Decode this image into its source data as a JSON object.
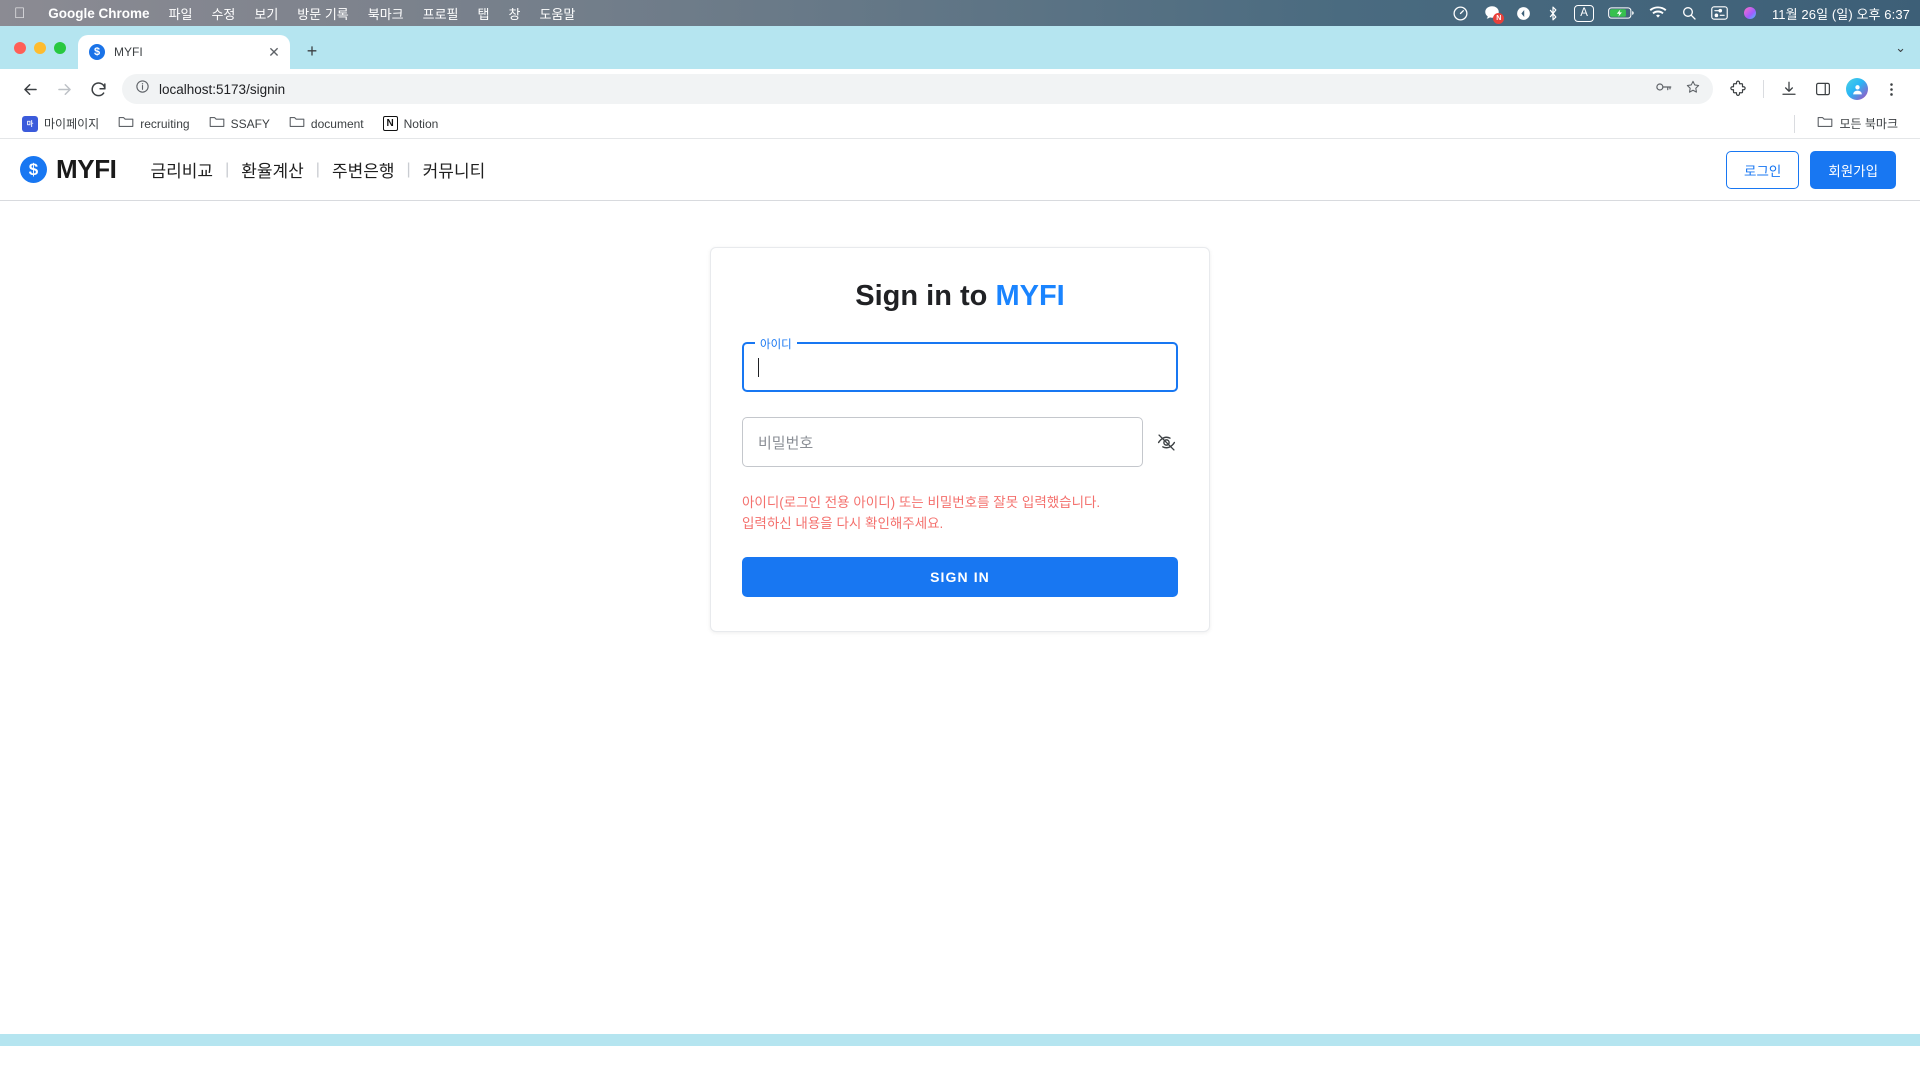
{
  "os_menubar": {
    "apple_icon": "apple-logo",
    "app_name": "Google Chrome",
    "menus": [
      "파일",
      "수정",
      "보기",
      "방문 기록",
      "북마크",
      "프로필",
      "탭",
      "창",
      "도움말"
    ],
    "status_icons": [
      "timer-icon",
      "messages-icon",
      "dropbox-icon",
      "bluetooth-icon",
      "input-source-icon",
      "battery-icon",
      "wifi-icon",
      "search-icon",
      "control-center-icon",
      "siri-icon"
    ],
    "input_source_label": "A",
    "messages_badge": "N",
    "datetime": "11월 26일 (일) 오후 6:37"
  },
  "browser": {
    "tab": {
      "favicon": "dollar-circle-favicon",
      "favicon_glyph": "$",
      "title": "MYFI",
      "close_label": "✕"
    },
    "new_tab_label": "+",
    "tab_list_chevron": "⌄",
    "toolbar": {
      "back_label": "←",
      "forward_label": "→",
      "reload_label": "⟳",
      "site_info_icon": "info-circle-icon",
      "url": "localhost:5173/signin",
      "password_key_icon": "password-key-icon",
      "bookmark_star_icon": "star-icon",
      "extensions_icon": "extensions-puzzle-icon",
      "downloads_icon": "download-icon",
      "side_panel_icon": "side-panel-icon",
      "profile_icon": "profile-avatar",
      "menu_icon": "three-dots-menu-icon"
    },
    "bookmarks": [
      {
        "label": "마이페이지",
        "icon": "site-favicon",
        "icon_glyph": "마"
      },
      {
        "label": "recruiting",
        "icon": "folder-icon"
      },
      {
        "label": "SSAFY",
        "icon": "folder-icon"
      },
      {
        "label": "document",
        "icon": "folder-icon"
      },
      {
        "label": "Notion",
        "icon": "notion-favicon",
        "icon_glyph": "N"
      }
    ],
    "bookmarks_overflow": {
      "label": "모든 북마크",
      "icon": "folder-icon"
    }
  },
  "site": {
    "brand": {
      "mark_glyph": "$",
      "name": "MYFI"
    },
    "nav": [
      {
        "label": "금리비교"
      },
      {
        "label": "환율계산"
      },
      {
        "label": "주변은행"
      },
      {
        "label": "커뮤니티"
      }
    ],
    "nav_separator": "|",
    "actions": {
      "login_label": "로그인",
      "signup_label": "회원가입"
    },
    "accent_color": "#1877f2"
  },
  "signin_card": {
    "title_prefix": "Sign in to ",
    "title_brand": "MYFI",
    "id_field": {
      "label": "아이디",
      "value": "",
      "focused": true
    },
    "password_field": {
      "placeholder": "비밀번호",
      "value": "",
      "toggle_icon": "eye-off-icon"
    },
    "errors": [
      "아이디(로그인 전용 아이디) 또는 비밀번호를 잘못 입력했습니다.",
      "입력하신 내용을 다시 확인해주세요."
    ],
    "error_color": "#f4706d",
    "submit_label": "SIGN IN"
  }
}
